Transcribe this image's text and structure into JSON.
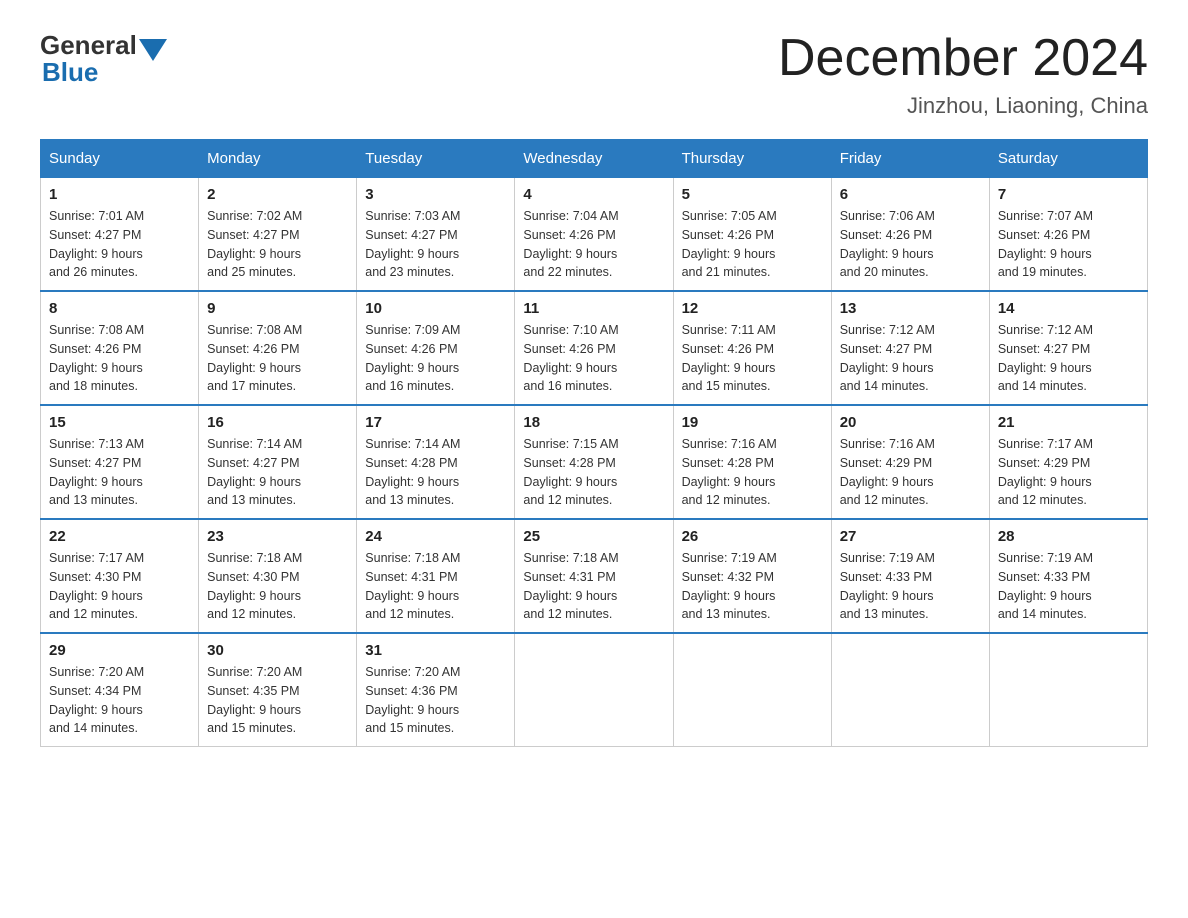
{
  "logo": {
    "text_general": "General",
    "text_blue": "Blue"
  },
  "title": "December 2024",
  "subtitle": "Jinzhou, Liaoning, China",
  "days_of_week": [
    "Sunday",
    "Monday",
    "Tuesday",
    "Wednesday",
    "Thursday",
    "Friday",
    "Saturday"
  ],
  "weeks": [
    [
      {
        "day": "1",
        "sunrise": "7:01 AM",
        "sunset": "4:27 PM",
        "daylight": "9 hours and 26 minutes."
      },
      {
        "day": "2",
        "sunrise": "7:02 AM",
        "sunset": "4:27 PM",
        "daylight": "9 hours and 25 minutes."
      },
      {
        "day": "3",
        "sunrise": "7:03 AM",
        "sunset": "4:27 PM",
        "daylight": "9 hours and 23 minutes."
      },
      {
        "day": "4",
        "sunrise": "7:04 AM",
        "sunset": "4:26 PM",
        "daylight": "9 hours and 22 minutes."
      },
      {
        "day": "5",
        "sunrise": "7:05 AM",
        "sunset": "4:26 PM",
        "daylight": "9 hours and 21 minutes."
      },
      {
        "day": "6",
        "sunrise": "7:06 AM",
        "sunset": "4:26 PM",
        "daylight": "9 hours and 20 minutes."
      },
      {
        "day": "7",
        "sunrise": "7:07 AM",
        "sunset": "4:26 PM",
        "daylight": "9 hours and 19 minutes."
      }
    ],
    [
      {
        "day": "8",
        "sunrise": "7:08 AM",
        "sunset": "4:26 PM",
        "daylight": "9 hours and 18 minutes."
      },
      {
        "day": "9",
        "sunrise": "7:08 AM",
        "sunset": "4:26 PM",
        "daylight": "9 hours and 17 minutes."
      },
      {
        "day": "10",
        "sunrise": "7:09 AM",
        "sunset": "4:26 PM",
        "daylight": "9 hours and 16 minutes."
      },
      {
        "day": "11",
        "sunrise": "7:10 AM",
        "sunset": "4:26 PM",
        "daylight": "9 hours and 16 minutes."
      },
      {
        "day": "12",
        "sunrise": "7:11 AM",
        "sunset": "4:26 PM",
        "daylight": "9 hours and 15 minutes."
      },
      {
        "day": "13",
        "sunrise": "7:12 AM",
        "sunset": "4:27 PM",
        "daylight": "9 hours and 14 minutes."
      },
      {
        "day": "14",
        "sunrise": "7:12 AM",
        "sunset": "4:27 PM",
        "daylight": "9 hours and 14 minutes."
      }
    ],
    [
      {
        "day": "15",
        "sunrise": "7:13 AM",
        "sunset": "4:27 PM",
        "daylight": "9 hours and 13 minutes."
      },
      {
        "day": "16",
        "sunrise": "7:14 AM",
        "sunset": "4:27 PM",
        "daylight": "9 hours and 13 minutes."
      },
      {
        "day": "17",
        "sunrise": "7:14 AM",
        "sunset": "4:28 PM",
        "daylight": "9 hours and 13 minutes."
      },
      {
        "day": "18",
        "sunrise": "7:15 AM",
        "sunset": "4:28 PM",
        "daylight": "9 hours and 12 minutes."
      },
      {
        "day": "19",
        "sunrise": "7:16 AM",
        "sunset": "4:28 PM",
        "daylight": "9 hours and 12 minutes."
      },
      {
        "day": "20",
        "sunrise": "7:16 AM",
        "sunset": "4:29 PM",
        "daylight": "9 hours and 12 minutes."
      },
      {
        "day": "21",
        "sunrise": "7:17 AM",
        "sunset": "4:29 PM",
        "daylight": "9 hours and 12 minutes."
      }
    ],
    [
      {
        "day": "22",
        "sunrise": "7:17 AM",
        "sunset": "4:30 PM",
        "daylight": "9 hours and 12 minutes."
      },
      {
        "day": "23",
        "sunrise": "7:18 AM",
        "sunset": "4:30 PM",
        "daylight": "9 hours and 12 minutes."
      },
      {
        "day": "24",
        "sunrise": "7:18 AM",
        "sunset": "4:31 PM",
        "daylight": "9 hours and 12 minutes."
      },
      {
        "day": "25",
        "sunrise": "7:18 AM",
        "sunset": "4:31 PM",
        "daylight": "9 hours and 12 minutes."
      },
      {
        "day": "26",
        "sunrise": "7:19 AM",
        "sunset": "4:32 PM",
        "daylight": "9 hours and 13 minutes."
      },
      {
        "day": "27",
        "sunrise": "7:19 AM",
        "sunset": "4:33 PM",
        "daylight": "9 hours and 13 minutes."
      },
      {
        "day": "28",
        "sunrise": "7:19 AM",
        "sunset": "4:33 PM",
        "daylight": "9 hours and 14 minutes."
      }
    ],
    [
      {
        "day": "29",
        "sunrise": "7:20 AM",
        "sunset": "4:34 PM",
        "daylight": "9 hours and 14 minutes."
      },
      {
        "day": "30",
        "sunrise": "7:20 AM",
        "sunset": "4:35 PM",
        "daylight": "9 hours and 15 minutes."
      },
      {
        "day": "31",
        "sunrise": "7:20 AM",
        "sunset": "4:36 PM",
        "daylight": "9 hours and 15 minutes."
      },
      null,
      null,
      null,
      null
    ]
  ],
  "labels": {
    "sunrise": "Sunrise:",
    "sunset": "Sunset:",
    "daylight": "Daylight:"
  },
  "colors": {
    "header_bg": "#2a7abf",
    "header_text": "#ffffff",
    "border": "#2a7abf",
    "logo_blue": "#1a6daf"
  }
}
